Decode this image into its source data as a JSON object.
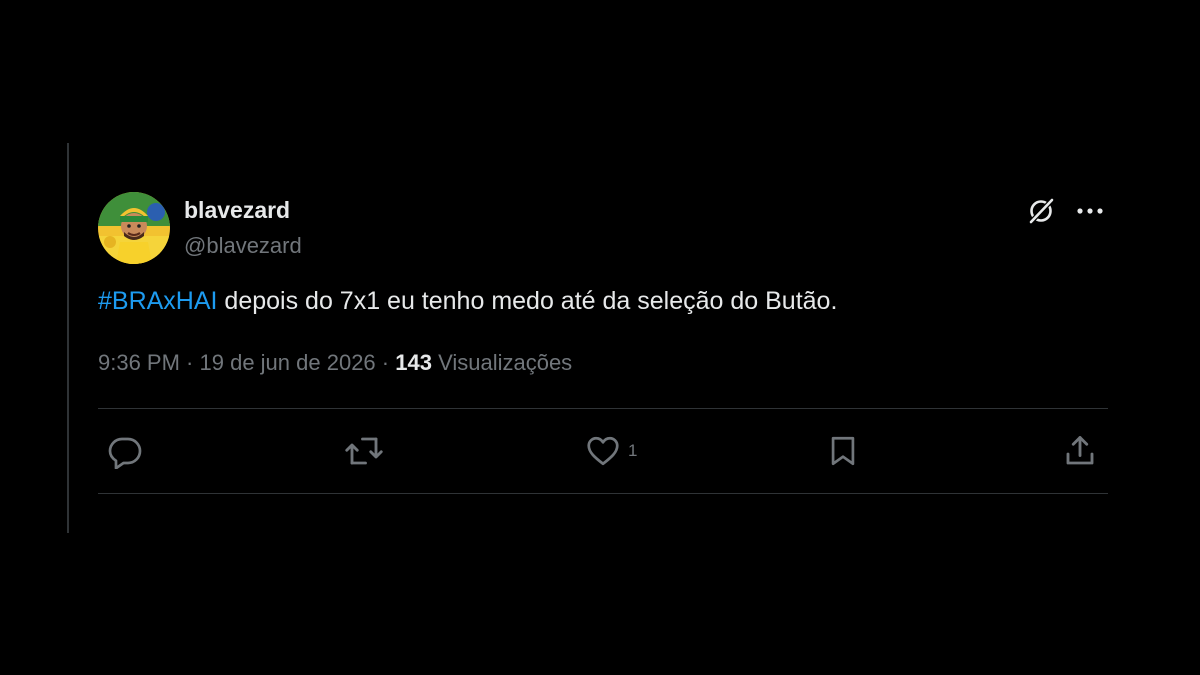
{
  "tweet": {
    "display_name": "blavezard",
    "handle": "@blavezard",
    "hashtag": "#BRAxHAI",
    "text": " depois do 7x1 eu tenho medo até da seleção do Butão.",
    "time": "9:36 PM",
    "separator": " · ",
    "date": "19 de jun de 2026",
    "views_count": "143",
    "views_label": " Visualizações"
  },
  "actions": {
    "reply_count": "",
    "retweet_count": "",
    "like_count": "1",
    "bookmark_count": ""
  },
  "icons": {
    "reply": "reply-icon",
    "retweet": "retweet-icon",
    "like": "heart-icon",
    "bookmark": "bookmark-icon",
    "share": "share-icon",
    "grok": "grok-icon",
    "more": "more-icon"
  },
  "colors": {
    "background": "#000000",
    "primary_text": "#e7e9ea",
    "secondary_text": "#71767b",
    "link": "#1d9bf0",
    "border": "#2f3336"
  }
}
